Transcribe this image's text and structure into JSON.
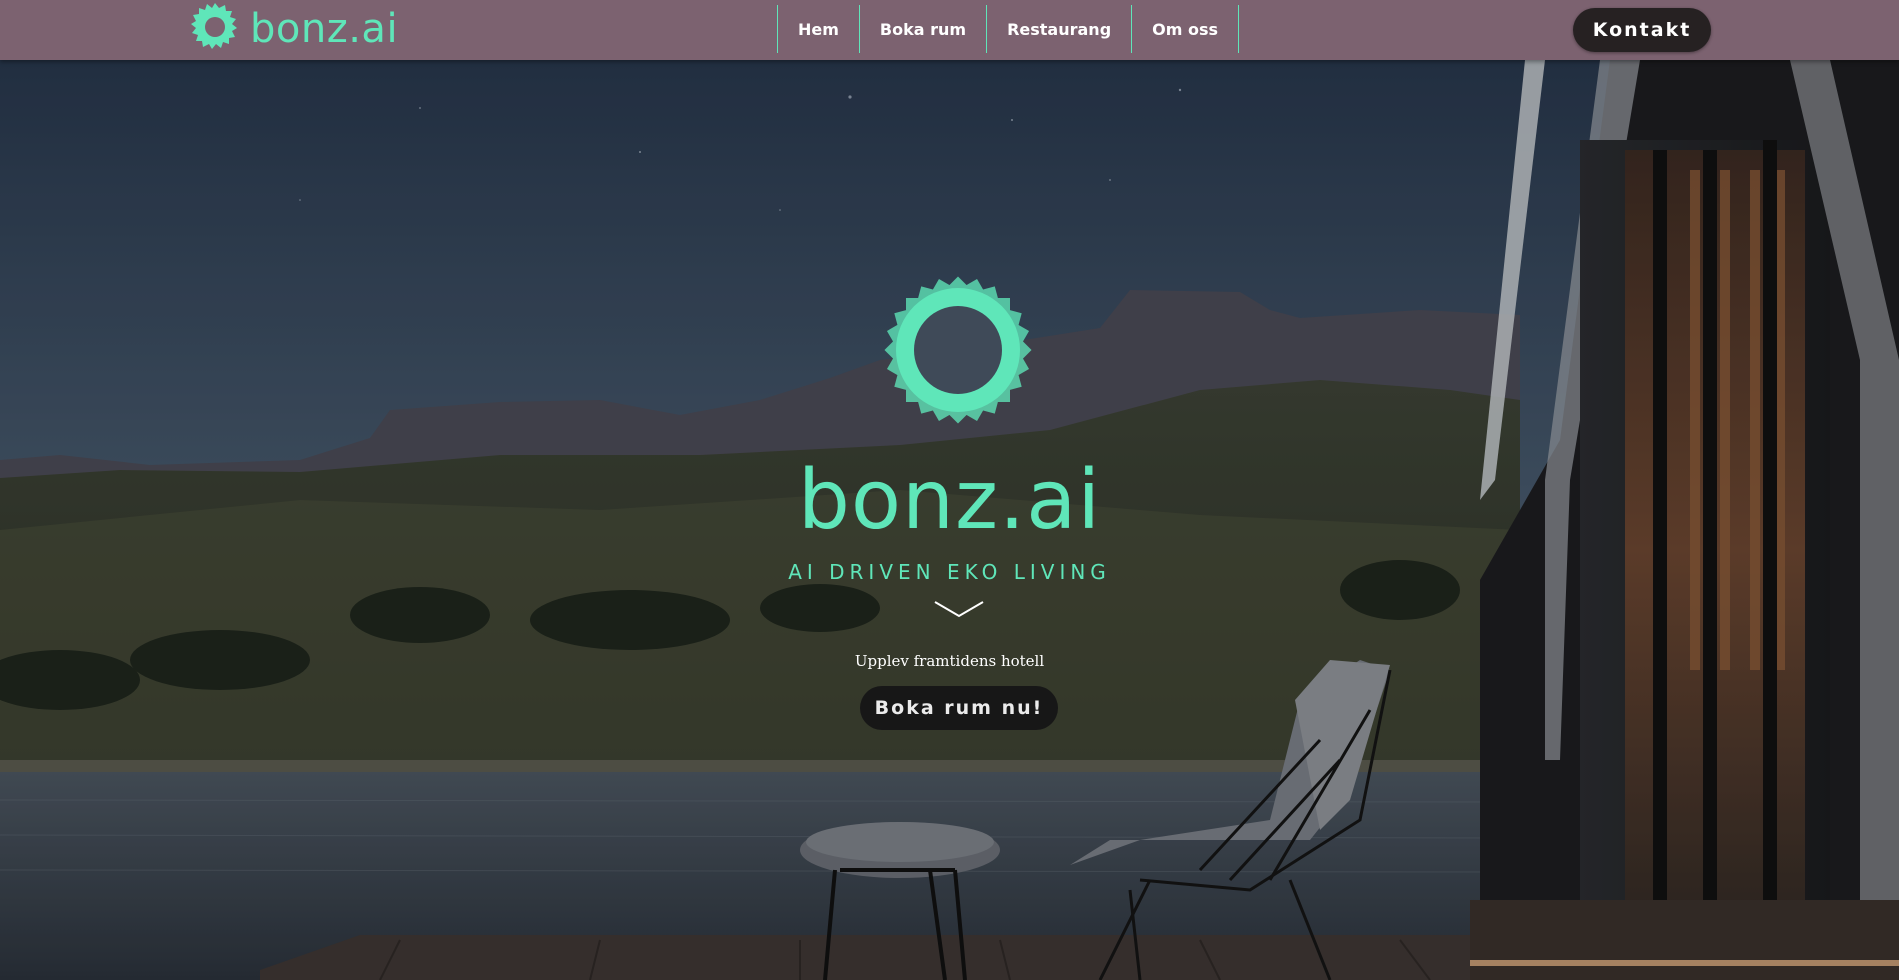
{
  "header": {
    "brand": "bonz.ai",
    "nav": [
      "Hem",
      "Boka rum",
      "Restaurang",
      "Om oss"
    ],
    "contact_label": "Kontakt"
  },
  "hero": {
    "wordmark": "bonz.ai",
    "tagline": "AI DRIVEN EKO LIVING",
    "subtitle": "Upplev framtidens hotell",
    "cta_label": "Boka rum nu!"
  },
  "colors": {
    "accent": "#5fe6b9",
    "header_bg": "#7c6270",
    "button_bg": "#262122"
  },
  "icons": {
    "brand_logo": "sun-ring-icon",
    "scroll_hint": "chevron-down-icon"
  }
}
